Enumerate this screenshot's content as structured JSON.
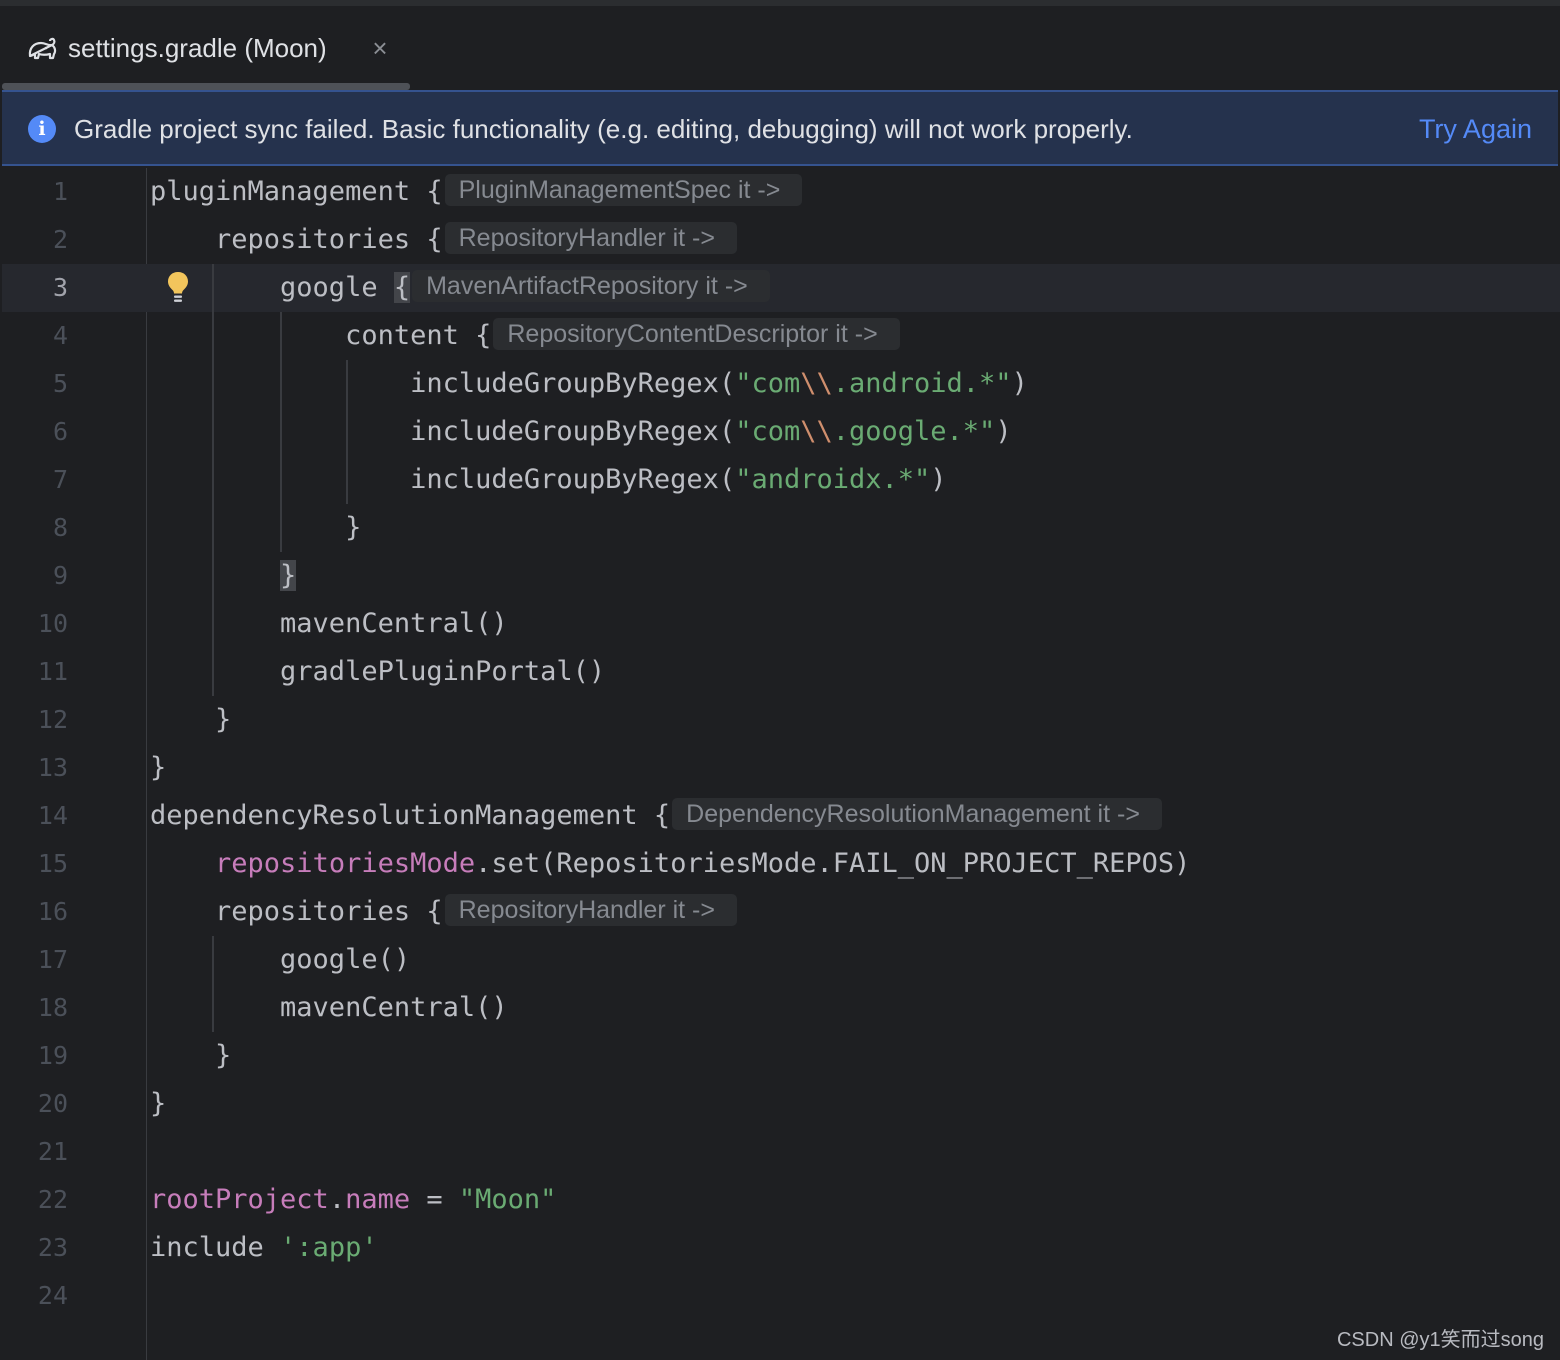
{
  "tab": {
    "title": "settings.gradle (Moon)",
    "close_symbol": "×",
    "icon": "gradle-elephant-icon"
  },
  "banner": {
    "message": "Gradle project sync failed. Basic functionality (e.g. editing, debugging) will not work properly.",
    "action": "Try Again",
    "icon": "info-icon",
    "icon_glyph": "i"
  },
  "editor": {
    "current_line": 3,
    "lines": [
      {
        "n": "1",
        "text": "pluginManagement {",
        "hint": "PluginManagementSpec it ->"
      },
      {
        "n": "2",
        "text": "    repositories {",
        "hint": "RepositoryHandler it ->"
      },
      {
        "n": "3",
        "text": "        google {",
        "hint": "MavenArtifactRepository it ->"
      },
      {
        "n": "4",
        "text": "            content {",
        "hint": "RepositoryContentDescriptor it ->"
      },
      {
        "n": "5",
        "text": "                includeGroupByRegex(\"com\\\\.android.*\")",
        "hint": ""
      },
      {
        "n": "6",
        "text": "                includeGroupByRegex(\"com\\\\.google.*\")",
        "hint": ""
      },
      {
        "n": "7",
        "text": "                includeGroupByRegex(\"androidx.*\")",
        "hint": ""
      },
      {
        "n": "8",
        "text": "            }",
        "hint": ""
      },
      {
        "n": "9",
        "text": "        }",
        "hint": ""
      },
      {
        "n": "10",
        "text": "        mavenCentral()",
        "hint": ""
      },
      {
        "n": "11",
        "text": "        gradlePluginPortal()",
        "hint": ""
      },
      {
        "n": "12",
        "text": "    }",
        "hint": ""
      },
      {
        "n": "13",
        "text": "}",
        "hint": ""
      },
      {
        "n": "14",
        "text": "dependencyResolutionManagement {",
        "hint": "DependencyResolutionManagement it ->"
      },
      {
        "n": "15",
        "text": "    repositoriesMode.set(RepositoriesMode.FAIL_ON_PROJECT_REPOS)",
        "hint": ""
      },
      {
        "n": "16",
        "text": "    repositories {",
        "hint": "RepositoryHandler it ->"
      },
      {
        "n": "17",
        "text": "        google()",
        "hint": ""
      },
      {
        "n": "18",
        "text": "        mavenCentral()",
        "hint": ""
      },
      {
        "n": "19",
        "text": "    }",
        "hint": ""
      },
      {
        "n": "20",
        "text": "}",
        "hint": ""
      },
      {
        "n": "21",
        "text": "",
        "hint": ""
      },
      {
        "n": "22",
        "text": "rootProject.name = \"Moon\"",
        "hint": ""
      },
      {
        "n": "23",
        "text": "include ':app'",
        "hint": ""
      },
      {
        "n": "24",
        "text": "",
        "hint": ""
      }
    ]
  },
  "gutter_icon": "lightbulb-icon",
  "watermark": "CSDN @y1笑而过song",
  "colors": {
    "background": "#1e1f22",
    "code_text": "#bcbec4",
    "string": "#6aab73",
    "escape": "#cf8e6d",
    "property": "#c77dbb",
    "link": "#548af7",
    "banner_bg": "#25324d",
    "hint_text": "#868a91"
  }
}
